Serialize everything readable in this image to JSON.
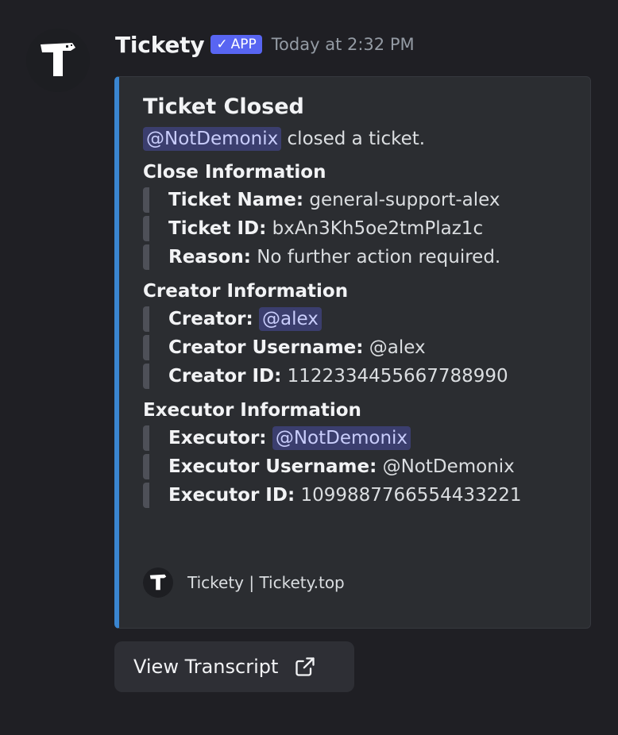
{
  "message": {
    "author": "Tickety",
    "badge": "APP",
    "badge_check": "✓",
    "timestamp": "Today at 2:32 PM",
    "avatar_letter": "T"
  },
  "embed": {
    "accent_color": "#3a85d0",
    "title": "Ticket Closed",
    "description_mention": "@NotDemonix",
    "description_text": " closed a ticket.",
    "sections": [
      {
        "title": "Close Information",
        "rows": [
          {
            "label": "Ticket Name:",
            "value": " general-support-alex"
          },
          {
            "label": "Ticket ID:",
            "value": " bxAn3Kh5oe2tmPlaz1c"
          },
          {
            "label": "Reason:",
            "value": " No further action required."
          }
        ]
      },
      {
        "title": "Creator Information",
        "rows": [
          {
            "label": "Creator:",
            "mention": "@alex"
          },
          {
            "label": "Creator Username:",
            "value": " @alex"
          },
          {
            "label": "Creator ID:",
            "value": " 1122334455667788990"
          }
        ]
      },
      {
        "title": "Executor Information",
        "rows": [
          {
            "label": "Executor:",
            "mention": "@NotDemonix"
          },
          {
            "label": "Executor Username:",
            "value": " @NotDemonix"
          },
          {
            "label": "Executor ID:",
            "value": " 1099887766554433221"
          }
        ]
      }
    ],
    "footer_text": "Tickety | Tickety.top"
  },
  "button": {
    "label": "View Transcript",
    "icon": "external-link-icon"
  }
}
